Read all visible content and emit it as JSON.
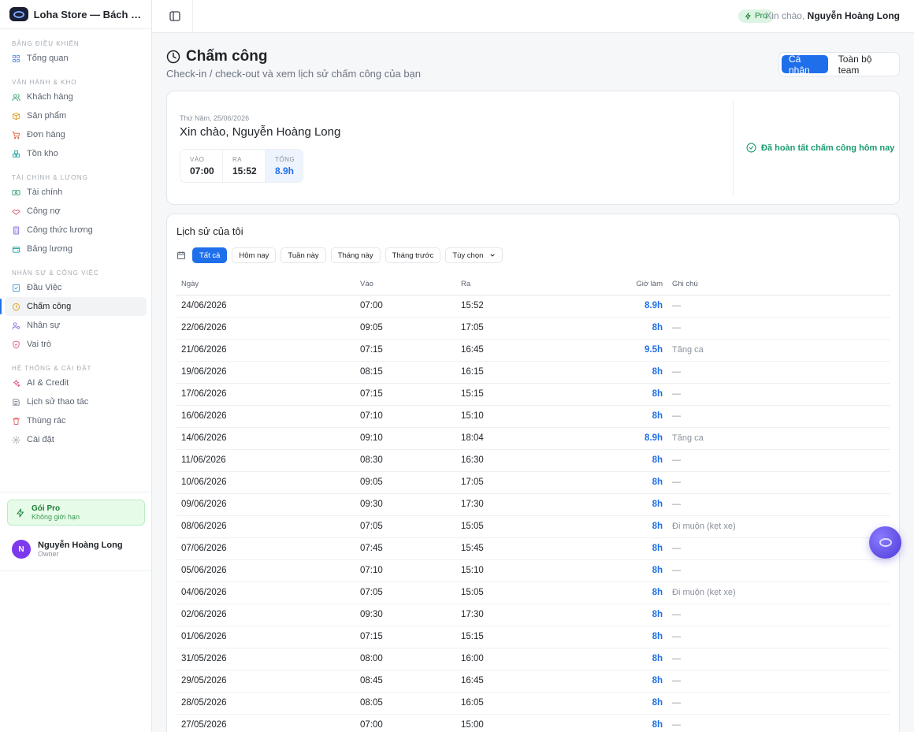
{
  "app": {
    "name": "Loha Store — Bách hóa Loha"
  },
  "sidebar": {
    "sections": [
      {
        "title": "Bảng điều khiển",
        "items": [
          {
            "label": "Tổng quan",
            "icon": "grid-icon"
          }
        ]
      },
      {
        "title": "Vận hành & Kho",
        "items": [
          {
            "label": "Khách hàng",
            "icon": "users-icon"
          },
          {
            "label": "Sản phẩm",
            "icon": "box-icon"
          },
          {
            "label": "Đơn hàng",
            "icon": "cart-icon"
          },
          {
            "label": "Tồn kho",
            "icon": "boxes-icon"
          }
        ]
      },
      {
        "title": "Tài chính & Lương",
        "items": [
          {
            "label": "Tài chính",
            "icon": "banknote-icon"
          },
          {
            "label": "Công nợ",
            "icon": "handshake-icon"
          },
          {
            "label": "Công thức lương",
            "icon": "calculator-icon"
          },
          {
            "label": "Bảng lương",
            "icon": "wallet-icon"
          }
        ]
      },
      {
        "title": "Nhân sự & Công việc",
        "items": [
          {
            "label": "Đầu Việc",
            "icon": "checkbox-icon"
          },
          {
            "label": "Chấm công",
            "icon": "clock-icon",
            "active": true
          },
          {
            "label": "Nhân sự",
            "icon": "user-cog-icon"
          },
          {
            "label": "Vai trò",
            "icon": "shield-icon"
          }
        ]
      },
      {
        "title": "Hệ thống & Cài đặt",
        "items": [
          {
            "label": "AI & Credit",
            "icon": "sparkles-icon"
          },
          {
            "label": "Lịch sử thao tác",
            "icon": "history-icon"
          },
          {
            "label": "Thùng rác",
            "icon": "trash-icon"
          },
          {
            "label": "Cài đặt",
            "icon": "gear-icon"
          }
        ]
      }
    ],
    "pro": {
      "title": "Gói Pro",
      "subtitle": "Không giới hạn"
    },
    "user": {
      "initial": "N",
      "name": "Nguyễn Hoàng Long",
      "role": "Owner"
    }
  },
  "topbar": {
    "badge": "Pro",
    "greeting_prefix": "Xin chào,",
    "user_name": "Nguyễn Hoàng Long"
  },
  "page": {
    "title": "Chấm công",
    "subtitle": "Check-in / check-out và xem lịch sử chấm công của bạn",
    "scope_options": [
      "Cá nhân",
      "Toàn bộ team"
    ],
    "scope_selected": "Cá nhân"
  },
  "today": {
    "date": "Thứ Năm, 25/06/2026",
    "greeting": "Xin chào, Nguyễn Hoàng Long",
    "stats": [
      {
        "label": "Vào",
        "value": "07:00"
      },
      {
        "label": "Ra",
        "value": "15:52"
      },
      {
        "label": "Tổng",
        "value": "8.9h"
      }
    ],
    "status": "Đã hoàn tất chấm công hôm nay"
  },
  "history": {
    "title": "Lịch sử của tôi",
    "filters": [
      "Tất cả",
      "Hôm nay",
      "Tuần này",
      "Tháng này",
      "Tháng trước"
    ],
    "filter_selected": "Tất cả",
    "custom_filter": "Tùy chọn",
    "columns": {
      "date": "Ngày",
      "in": "Vào",
      "out": "Ra",
      "hours": "Giờ làm",
      "note": "Ghi chú"
    },
    "rows": [
      {
        "date": "24/06/2026",
        "in": "07:00",
        "out": "15:52",
        "hours": "8.9h",
        "note": "—"
      },
      {
        "date": "22/06/2026",
        "in": "09:05",
        "out": "17:05",
        "hours": "8h",
        "note": "—"
      },
      {
        "date": "21/06/2026",
        "in": "07:15",
        "out": "16:45",
        "hours": "9.5h",
        "note": "Tăng ca"
      },
      {
        "date": "19/06/2026",
        "in": "08:15",
        "out": "16:15",
        "hours": "8h",
        "note": "—"
      },
      {
        "date": "17/06/2026",
        "in": "07:15",
        "out": "15:15",
        "hours": "8h",
        "note": "—"
      },
      {
        "date": "16/06/2026",
        "in": "07:10",
        "out": "15:10",
        "hours": "8h",
        "note": "—"
      },
      {
        "date": "14/06/2026",
        "in": "09:10",
        "out": "18:04",
        "hours": "8.9h",
        "note": "Tăng ca"
      },
      {
        "date": "11/06/2026",
        "in": "08:30",
        "out": "16:30",
        "hours": "8h",
        "note": "—"
      },
      {
        "date": "10/06/2026",
        "in": "09:05",
        "out": "17:05",
        "hours": "8h",
        "note": "—"
      },
      {
        "date": "09/06/2026",
        "in": "09:30",
        "out": "17:30",
        "hours": "8h",
        "note": "—"
      },
      {
        "date": "08/06/2026",
        "in": "07:05",
        "out": "15:05",
        "hours": "8h",
        "note": "Đi muộn (kẹt xe)"
      },
      {
        "date": "07/06/2026",
        "in": "07:45",
        "out": "15:45",
        "hours": "8h",
        "note": "—"
      },
      {
        "date": "05/06/2026",
        "in": "07:10",
        "out": "15:10",
        "hours": "8h",
        "note": "—"
      },
      {
        "date": "04/06/2026",
        "in": "07:05",
        "out": "15:05",
        "hours": "8h",
        "note": "Đi muộn (kẹt xe)"
      },
      {
        "date": "02/06/2026",
        "in": "09:30",
        "out": "17:30",
        "hours": "8h",
        "note": "—"
      },
      {
        "date": "01/06/2026",
        "in": "07:15",
        "out": "15:15",
        "hours": "8h",
        "note": "—"
      },
      {
        "date": "31/05/2026",
        "in": "08:00",
        "out": "16:00",
        "hours": "8h",
        "note": "—"
      },
      {
        "date": "29/05/2026",
        "in": "08:45",
        "out": "16:45",
        "hours": "8h",
        "note": "—"
      },
      {
        "date": "28/05/2026",
        "in": "08:05",
        "out": "16:05",
        "hours": "8h",
        "note": "—"
      },
      {
        "date": "27/05/2026",
        "in": "07:00",
        "out": "15:00",
        "hours": "8h",
        "note": "—"
      }
    ]
  },
  "assistant": {
    "icon": "ai-assistant-icon"
  },
  "colors": {
    "accent": "#1f6feb",
    "success": "#1a9b6f",
    "pro": "#1a7f37"
  }
}
